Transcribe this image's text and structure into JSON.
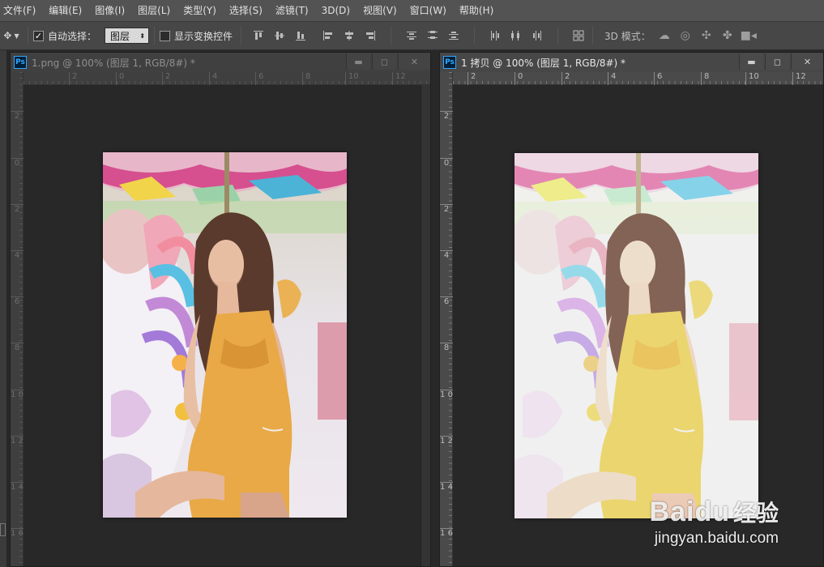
{
  "menubar": {
    "items": [
      "文件(F)",
      "编辑(E)",
      "图像(I)",
      "图层(L)",
      "类型(Y)",
      "选择(S)",
      "滤镜(T)",
      "3D(D)",
      "视图(V)",
      "窗口(W)",
      "帮助(H)"
    ]
  },
  "options": {
    "move_tool_icon": "move-tool-icon",
    "auto_select_label": "自动选择：",
    "auto_select_checked": "✓",
    "layer_select_value": "图层",
    "show_transform_label": "显示变换控件",
    "mode_3d_label": "3D 模式："
  },
  "doc_left": {
    "title": "1.png @ 100% (图层 1, RGB/8#) *",
    "logo": "Ps",
    "hruler": [
      "2",
      "0",
      "2",
      "4",
      "6",
      "8",
      "10",
      "12"
    ],
    "vruler": [
      "2",
      "0",
      "2",
      "4",
      "6",
      "8",
      "1 0",
      "1 2",
      "1 4",
      "1 6"
    ]
  },
  "doc_right": {
    "title": "1 拷贝 @ 100% (图层 1, RGB/8#) *",
    "logo": "Ps",
    "hruler": [
      "2",
      "0",
      "2",
      "4",
      "6",
      "8",
      "10",
      "12"
    ],
    "vruler": [
      "2",
      "0",
      "2",
      "4",
      "6",
      "8",
      "1 0",
      "1 2",
      "1 4",
      "1 6"
    ]
  },
  "window_buttons": {
    "minimize": "▬",
    "restore": "◻",
    "close": "✕"
  },
  "watermark": {
    "brand": "Baidu",
    "brand_cn": "经验",
    "url": "jingyan.baidu.com"
  }
}
